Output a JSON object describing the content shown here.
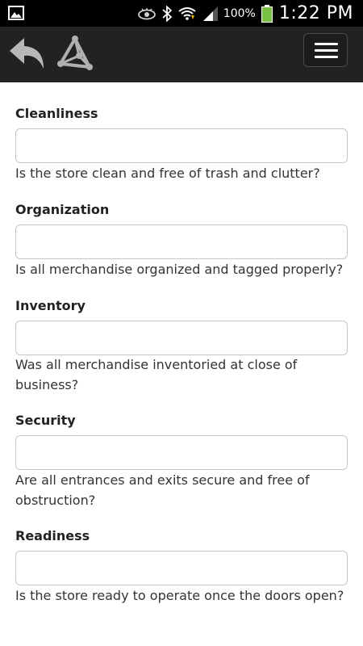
{
  "status_bar": {
    "icons": [
      "gallery-icon",
      "eye-icon",
      "bluetooth-icon",
      "wifi-icon",
      "signal-icon",
      "battery-icon"
    ],
    "battery_percent": "100%",
    "time": "1:22 PM",
    "battery_color": "#7ac143"
  },
  "header": {
    "icons": [
      "back-arrow-icon",
      "triangle-logo-icon",
      "hamburger-menu-icon"
    ],
    "background": "#222222"
  },
  "form": {
    "fields": [
      {
        "label": "Cleanliness",
        "value": "",
        "help": "Is the store clean and free of trash and clutter?"
      },
      {
        "label": "Organization",
        "value": "",
        "help": "Is all merchandise organized and tagged properly?"
      },
      {
        "label": "Inventory",
        "value": "",
        "help": "Was all merchandise inventoried at close of business?"
      },
      {
        "label": "Security",
        "value": "",
        "help": "Are all entrances and exits secure and free of obstruction?"
      },
      {
        "label": "Readiness",
        "value": "",
        "help": "Is the store ready to operate once the doors open?"
      }
    ]
  }
}
